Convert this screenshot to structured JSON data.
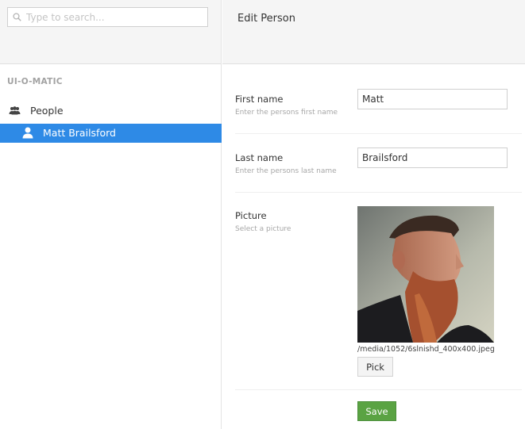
{
  "sidebar": {
    "search": {
      "placeholder": "Type to search..."
    },
    "section_title": "UI-O-MATIC",
    "tree": {
      "root_label": "People",
      "selected_item_label": "Matt Brailsford"
    }
  },
  "editor": {
    "title": "Edit Person",
    "fields": {
      "first_name": {
        "label": "First name",
        "description": "Enter the persons first name",
        "value": "Matt"
      },
      "last_name": {
        "label": "Last name",
        "description": "Enter the persons last name",
        "value": "Brailsford"
      },
      "picture": {
        "label": "Picture",
        "description": "Select a picture",
        "path": "/media/1052/6slnishd_400x400.jpeg",
        "pick_label": "Pick"
      }
    },
    "save_label": "Save"
  },
  "colors": {
    "selected_bg": "#2e8ae6",
    "save_button": "#5aa343"
  }
}
